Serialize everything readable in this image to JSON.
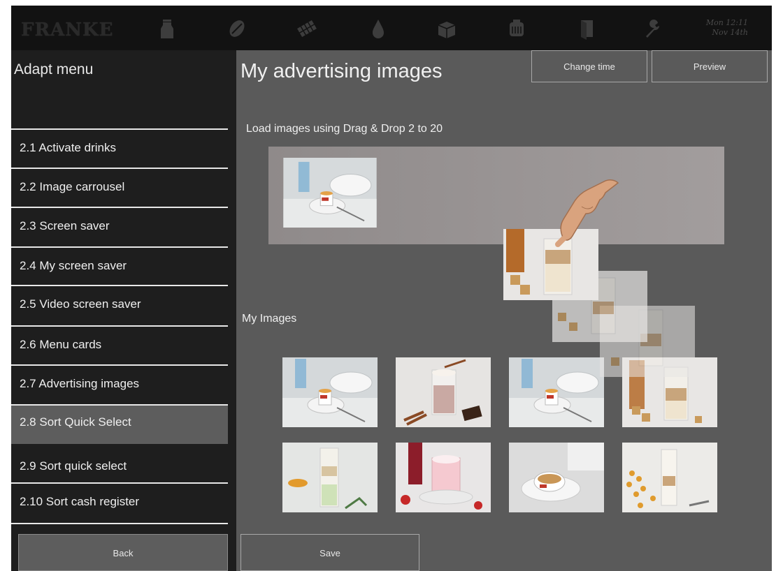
{
  "topbar": {
    "logo": "FRANKE",
    "icons": [
      "milk-icon",
      "coffee-bean-icon",
      "chocolate-icon",
      "water-drop-icon",
      "cleaning-box-icon",
      "grinder-icon",
      "door-icon",
      "wrench-icon"
    ],
    "clock_time": "Mon 12:11",
    "clock_date": "Nov 14th"
  },
  "sidebar": {
    "title": "Adapt menu",
    "items": [
      {
        "label": "2.1 Activate drinks"
      },
      {
        "label": "2.2 Image carrousel"
      },
      {
        "label": "2.3 Screen saver"
      },
      {
        "label": "2.4  My screen saver"
      },
      {
        "label": "2.5 Video screen saver"
      },
      {
        "label": "2.6 Menu cards"
      },
      {
        "label": "2.7 Advertising images"
      },
      {
        "label": "2.8 Sort Quick Select"
      },
      {
        "label": "2.9 Sort quick select"
      },
      {
        "label": "2.10 Sort cash register"
      }
    ],
    "selected_index": 7,
    "back_label": "Back"
  },
  "main": {
    "title": "My advertising images",
    "change_time_label": "Change time",
    "preview_label": "Preview",
    "drop_label": "Load images using Drag & Drop 2 to 20",
    "my_images_label": "My Images",
    "save_label": "Save"
  },
  "colors": {
    "background": "#5a5a5a",
    "sidebar": "#1e1e1e",
    "topbar": "#121212",
    "selected": "#5d5d5d",
    "dropzone": "#9a9595"
  }
}
